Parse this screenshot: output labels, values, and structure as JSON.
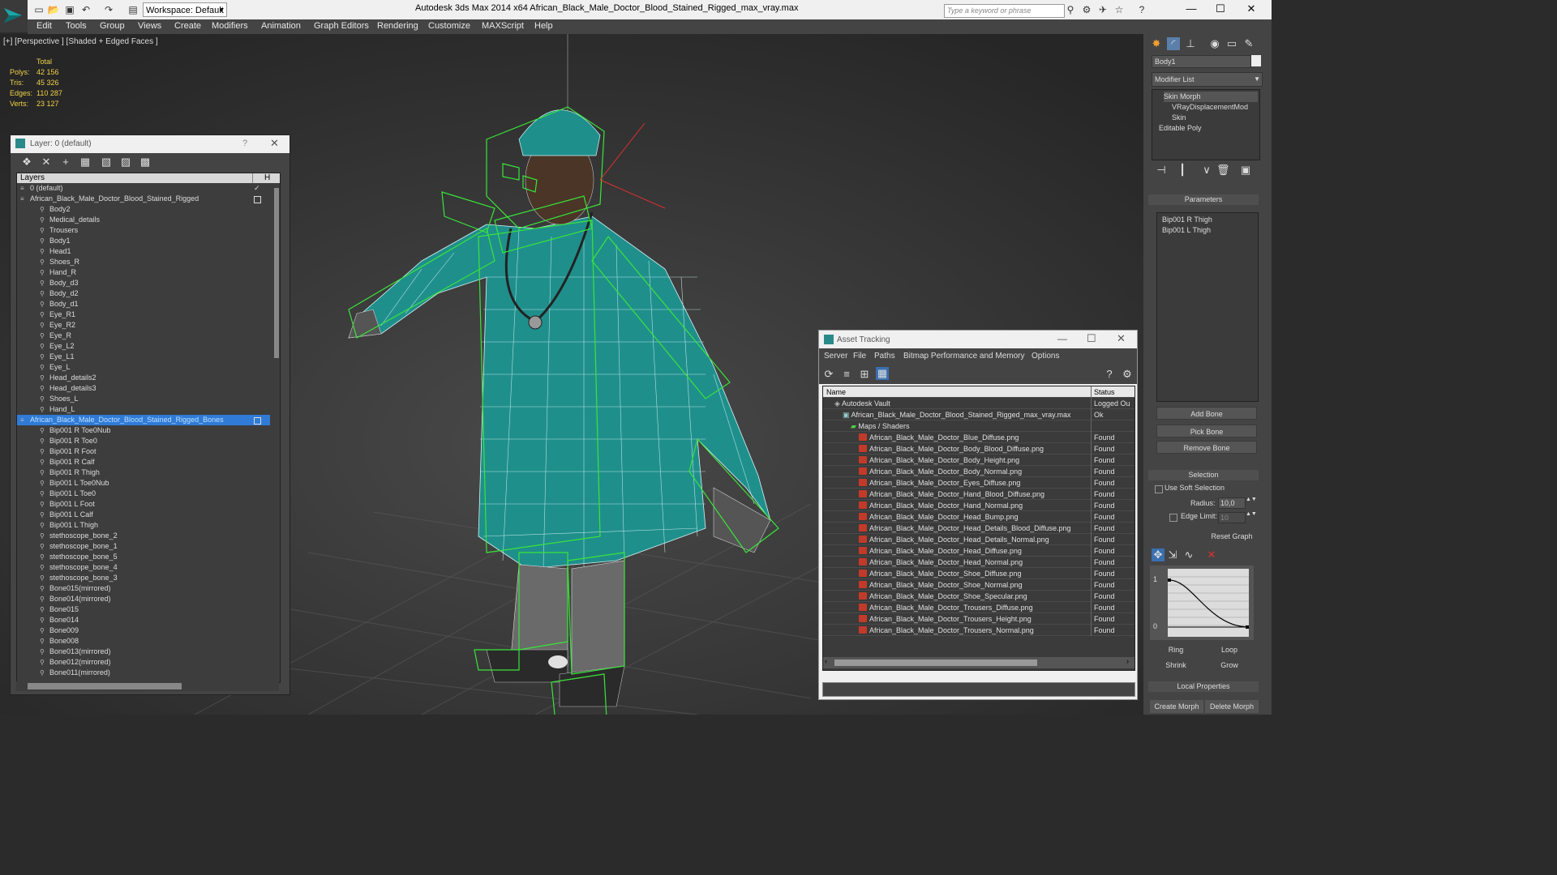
{
  "app": {
    "title": "Autodesk 3ds Max  2014 x64      African_Black_Male_Doctor_Blood_Stained_Rigged_max_vray.max",
    "workspace": "Workspace: Default",
    "search_placeholder": "Type a keyword or phrase"
  },
  "menu": [
    "Edit",
    "Tools",
    "Group",
    "Views",
    "Create",
    "Modifiers",
    "Animation",
    "Graph Editors",
    "Rendering",
    "Customize",
    "MAXScript",
    "Help"
  ],
  "viewport": {
    "label": "[+] [Perspective ] [Shaded + Edged Faces ]",
    "stats_header": "Total",
    "stats": [
      {
        "label": "Polys:",
        "value": "42 156"
      },
      {
        "label": "Tris:",
        "value": "45 326"
      },
      {
        "label": "Edges:",
        "value": "110 287"
      },
      {
        "label": "Verts:",
        "value": "23 127"
      }
    ]
  },
  "layer_panel": {
    "title": "Layer: 0 (default)",
    "help": "?",
    "col_layers": "Layers",
    "col_h": "H",
    "rows": [
      {
        "label": "0 (default)",
        "level": 0
      },
      {
        "label": "African_Black_Male_Doctor_Blood_Stained_Rigged",
        "level": 0
      },
      {
        "label": "Body2",
        "level": 1
      },
      {
        "label": "Medical_details",
        "level": 1
      },
      {
        "label": "Trousers",
        "level": 1
      },
      {
        "label": "Body1",
        "level": 1
      },
      {
        "label": "Head1",
        "level": 1
      },
      {
        "label": "Shoes_R",
        "level": 1
      },
      {
        "label": "Hand_R",
        "level": 1
      },
      {
        "label": "Body_d3",
        "level": 1
      },
      {
        "label": "Body_d2",
        "level": 1
      },
      {
        "label": "Body_d1",
        "level": 1
      },
      {
        "label": "Eye_R1",
        "level": 1
      },
      {
        "label": "Eye_R2",
        "level": 1
      },
      {
        "label": "Eye_R",
        "level": 1
      },
      {
        "label": "Eye_L2",
        "level": 1
      },
      {
        "label": "Eye_L1",
        "level": 1
      },
      {
        "label": "Eye_L",
        "level": 1
      },
      {
        "label": "Head_details2",
        "level": 1
      },
      {
        "label": "Head_details3",
        "level": 1
      },
      {
        "label": "Shoes_L",
        "level": 1
      },
      {
        "label": "Hand_L",
        "level": 1
      },
      {
        "label": "African_Black_Male_Doctor_Blood_Stained_Rigged_Bones",
        "level": 0,
        "selected": true
      },
      {
        "label": "Bip001 R Toe0Nub",
        "level": 1
      },
      {
        "label": "Bip001 R Toe0",
        "level": 1
      },
      {
        "label": "Bip001 R Foot",
        "level": 1
      },
      {
        "label": "Bip001 R Calf",
        "level": 1
      },
      {
        "label": "Bip001 R Thigh",
        "level": 1
      },
      {
        "label": "Bip001 L Toe0Nub",
        "level": 1
      },
      {
        "label": "Bip001 L Toe0",
        "level": 1
      },
      {
        "label": "Bip001 L Foot",
        "level": 1
      },
      {
        "label": "Bip001 L Calf",
        "level": 1
      },
      {
        "label": "Bip001 L Thigh",
        "level": 1
      },
      {
        "label": "stethoscope_bone_2",
        "level": 1
      },
      {
        "label": "stethoscope_bone_1",
        "level": 1
      },
      {
        "label": "stethoscope_bone_5",
        "level": 1
      },
      {
        "label": "stethoscope_bone_4",
        "level": 1
      },
      {
        "label": "stethoscope_bone_3",
        "level": 1
      },
      {
        "label": "Bone015(mirrored)",
        "level": 1
      },
      {
        "label": "Bone014(mirrored)",
        "level": 1
      },
      {
        "label": "Bone015",
        "level": 1
      },
      {
        "label": "Bone014",
        "level": 1
      },
      {
        "label": "Bone009",
        "level": 1
      },
      {
        "label": "Bone008",
        "level": 1
      },
      {
        "label": "Bone013(mirrored)",
        "level": 1
      },
      {
        "label": "Bone012(mirrored)",
        "level": 1
      },
      {
        "label": "Bone011(mirrored)",
        "level": 1
      }
    ]
  },
  "asset_tracking": {
    "title": "Asset Tracking",
    "menu": [
      "Server",
      "File",
      "Paths",
      "Bitmap Performance and Memory",
      "Options"
    ],
    "col_name": "Name",
    "col_status": "Status",
    "rows": [
      {
        "name": "Autodesk Vault",
        "status": "Logged Ou",
        "indent": 1,
        "icon": "vault"
      },
      {
        "name": "African_Black_Male_Doctor_Blood_Stained_Rigged_max_vray.max",
        "status": "Ok",
        "indent": 2,
        "icon": "max"
      },
      {
        "name": "Maps / Shaders",
        "status": "",
        "indent": 3,
        "icon": "folder"
      },
      {
        "name": "African_Black_Male_Doctor_Blue_Diffuse.png",
        "status": "Found",
        "indent": 4,
        "icon": "png"
      },
      {
        "name": "African_Black_Male_Doctor_Body_Blood_Diffuse.png",
        "status": "Found",
        "indent": 4,
        "icon": "png"
      },
      {
        "name": "African_Black_Male_Doctor_Body_Height.png",
        "status": "Found",
        "indent": 4,
        "icon": "png"
      },
      {
        "name": "African_Black_Male_Doctor_Body_Normal.png",
        "status": "Found",
        "indent": 4,
        "icon": "png"
      },
      {
        "name": "African_Black_Male_Doctor_Eyes_Diffuse.png",
        "status": "Found",
        "indent": 4,
        "icon": "png"
      },
      {
        "name": "African_Black_Male_Doctor_Hand_Blood_Diffuse.png",
        "status": "Found",
        "indent": 4,
        "icon": "png"
      },
      {
        "name": "African_Black_Male_Doctor_Hand_Normal.png",
        "status": "Found",
        "indent": 4,
        "icon": "png"
      },
      {
        "name": "African_Black_Male_Doctor_Head_Bump.png",
        "status": "Found",
        "indent": 4,
        "icon": "png"
      },
      {
        "name": "African_Black_Male_Doctor_Head_Details_Blood_Diffuse.png",
        "status": "Found",
        "indent": 4,
        "icon": "png"
      },
      {
        "name": "African_Black_Male_Doctor_Head_Details_Normal.png",
        "status": "Found",
        "indent": 4,
        "icon": "png"
      },
      {
        "name": "African_Black_Male_Doctor_Head_Diffuse.png",
        "status": "Found",
        "indent": 4,
        "icon": "png"
      },
      {
        "name": "African_Black_Male_Doctor_Head_Normal.png",
        "status": "Found",
        "indent": 4,
        "icon": "png"
      },
      {
        "name": "African_Black_Male_Doctor_Shoe_Diffuse.png",
        "status": "Found",
        "indent": 4,
        "icon": "png"
      },
      {
        "name": "African_Black_Male_Doctor_Shoe_Normal.png",
        "status": "Found",
        "indent": 4,
        "icon": "png"
      },
      {
        "name": "African_Black_Male_Doctor_Shoe_Specular.png",
        "status": "Found",
        "indent": 4,
        "icon": "png"
      },
      {
        "name": "African_Black_Male_Doctor_Trousers_Diffuse.png",
        "status": "Found",
        "indent": 4,
        "icon": "png"
      },
      {
        "name": "African_Black_Male_Doctor_Trousers_Height.png",
        "status": "Found",
        "indent": 4,
        "icon": "png"
      },
      {
        "name": "African_Black_Male_Doctor_Trousers_Normal.png",
        "status": "Found",
        "indent": 4,
        "icon": "png"
      }
    ]
  },
  "command_panel": {
    "object_name": "Body1",
    "modifier_list": "Modifier List",
    "stack": [
      "Skin Morph",
      "VRayDisplacementMod",
      "Skin",
      "Editable Poly"
    ],
    "parameters_title": "Parameters",
    "bones": [
      "Bip001 R Thigh",
      "Bip001 L Thigh"
    ],
    "add_bone": "Add Bone",
    "pick_bone": "Pick Bone",
    "remove_bone": "Remove Bone",
    "selection_title": "Selection",
    "use_soft_selection": "Use Soft Selection",
    "radius_label": "Radius:",
    "radius_value": "10,0",
    "edge_limit_label": "Edge Limit:",
    "edge_limit_value": "10",
    "reset_graph": "Reset Graph",
    "graph_y_top": "1",
    "graph_y_bottom": "0",
    "ring": "Ring",
    "loop": "Loop",
    "shrink": "Shrink",
    "grow": "Grow",
    "local_properties": "Local Properties",
    "create_morph": "Create Morph",
    "delete_morph": "Delete Morph"
  },
  "colors": {
    "accent": "#2f7bd6",
    "wire": "#39e53a",
    "coat": "#1f8f8c",
    "stat": "#f0d24a"
  }
}
